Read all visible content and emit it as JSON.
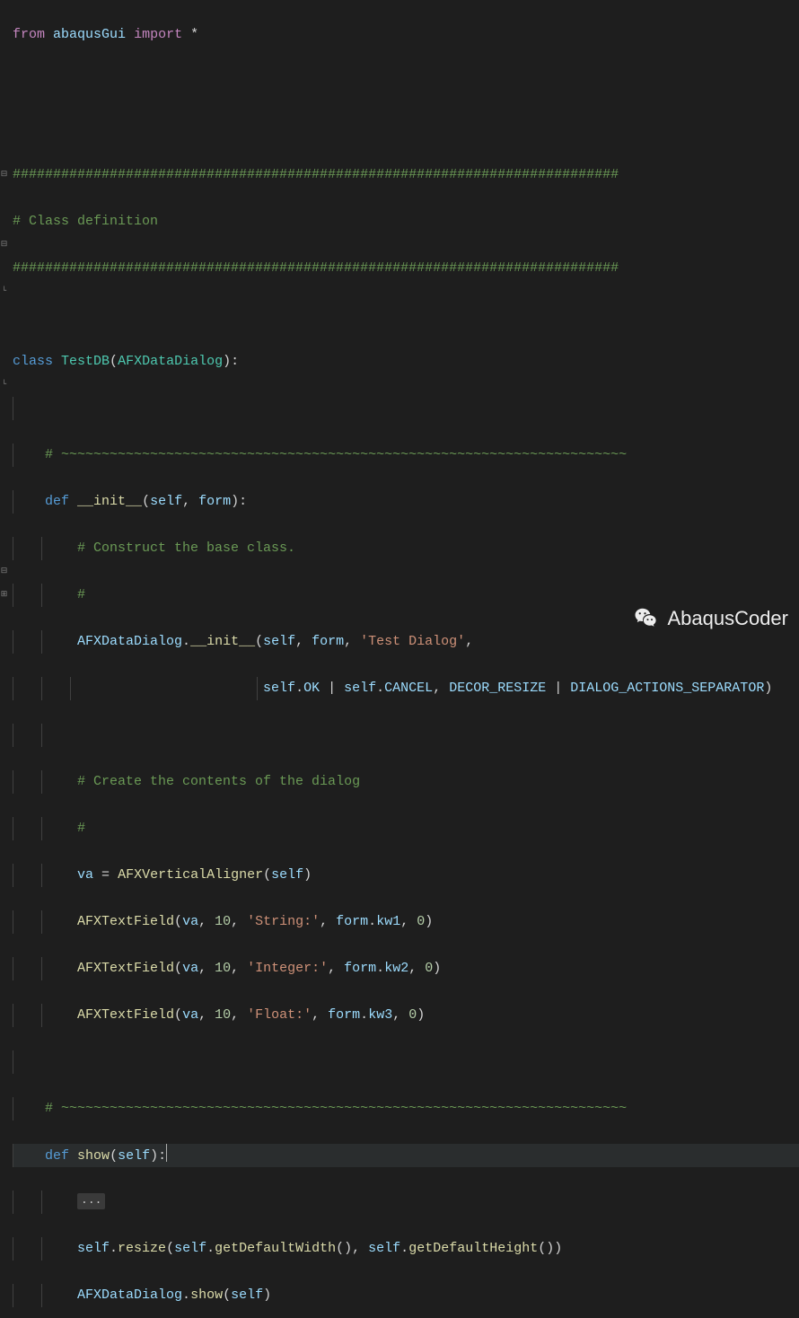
{
  "code": {
    "l1_from": "from",
    "l1_mod": "abaqusGui",
    "l1_import": "import",
    "l1_star": "*",
    "hash_rule": "###########################################################################",
    "class_def_cmt": "# Class definition",
    "class_kw": "class",
    "class_name": "TestDB",
    "base_class": "AFXDataDialog",
    "tilde_rule": "# ~~~~~~~~~~~~~~~~~~~~~~~~~~~~~~~~~~~~~~~~~~~~~~~~~~~~~~~~~~~~~~~~~~~~~~",
    "def_kw": "def",
    "init_name": "__init__",
    "self_kw": "self",
    "form_param": "form",
    "cmt_construct": "# Construct the base class.",
    "cmt_hash": "#",
    "dlg_title": "'Test Dialog'",
    "ok_const": "OK",
    "cancel_const": "CANCEL",
    "decor": "DECOR_RESIZE",
    "sep": "DIALOG_ACTIONS_SEPARATOR",
    "cmt_contents": "# Create the contents of the dialog",
    "va_var": "va",
    "aligner": "AFXVerticalAligner",
    "textfield": "AFXTextField",
    "ten": "10",
    "zero": "0",
    "str_lbl": "'String:'",
    "int_lbl": "'Integer:'",
    "flt_lbl": "'Float:'",
    "kw1": "kw1",
    "kw2": "kw2",
    "kw3": "kw3",
    "show_name": "show",
    "dots": "...",
    "resize": "resize",
    "getw": "getDefaultWidth",
    "geth": "getDefaultHeight",
    "show2": "show"
  },
  "watermark": {
    "text": "AbaqusCoder"
  }
}
